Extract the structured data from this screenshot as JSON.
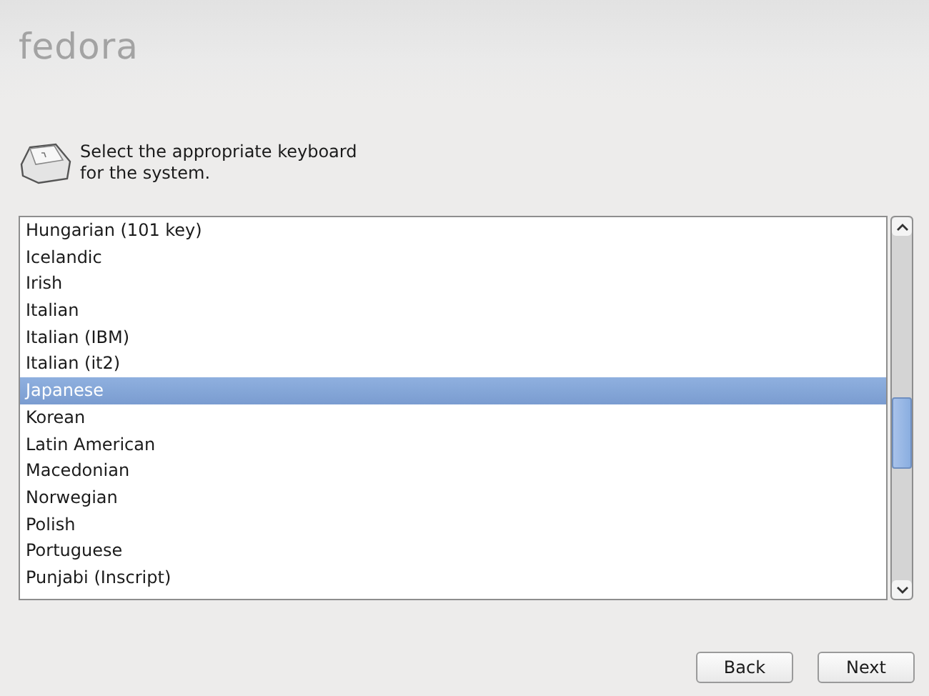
{
  "logo": "fedora",
  "instruction": "Select the appropriate keyboard for the system.",
  "keyboards": [
    {
      "label": "Hungarian (101 key)",
      "selected": false
    },
    {
      "label": "Icelandic",
      "selected": false
    },
    {
      "label": "Irish",
      "selected": false
    },
    {
      "label": "Italian",
      "selected": false
    },
    {
      "label": "Italian (IBM)",
      "selected": false
    },
    {
      "label": "Italian (it2)",
      "selected": false
    },
    {
      "label": "Japanese",
      "selected": true
    },
    {
      "label": "Korean",
      "selected": false
    },
    {
      "label": "Latin American",
      "selected": false
    },
    {
      "label": "Macedonian",
      "selected": false
    },
    {
      "label": "Norwegian",
      "selected": false
    },
    {
      "label": "Polish",
      "selected": false
    },
    {
      "label": "Portuguese",
      "selected": false
    },
    {
      "label": "Punjabi (Inscript)",
      "selected": false
    }
  ],
  "buttons": [
    "Back",
    "Next"
  ]
}
